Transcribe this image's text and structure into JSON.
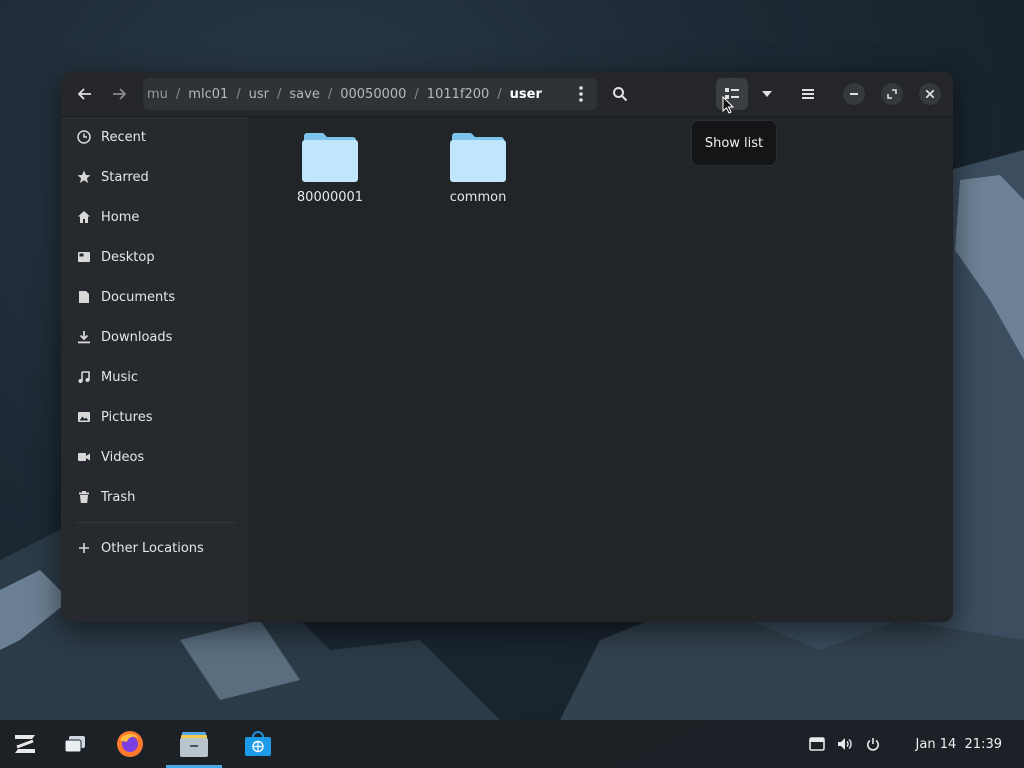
{
  "window": {
    "path": {
      "crumbs": [
        "mu",
        "mlc01",
        "usr",
        "save",
        "00050000",
        "1011f200",
        "user"
      ],
      "separator": "/"
    },
    "view_tooltip": "Show list"
  },
  "sidebar": {
    "items": [
      {
        "label": "Recent",
        "icon": "clock-icon"
      },
      {
        "label": "Starred",
        "icon": "star-icon"
      },
      {
        "label": "Home",
        "icon": "home-icon"
      },
      {
        "label": "Desktop",
        "icon": "desktop-icon"
      },
      {
        "label": "Documents",
        "icon": "document-icon"
      },
      {
        "label": "Downloads",
        "icon": "download-icon"
      },
      {
        "label": "Music",
        "icon": "music-icon"
      },
      {
        "label": "Pictures",
        "icon": "picture-icon"
      },
      {
        "label": "Videos",
        "icon": "video-icon"
      },
      {
        "label": "Trash",
        "icon": "trash-icon"
      }
    ],
    "other_locations": "Other Locations"
  },
  "files": [
    {
      "name": "80000001",
      "type": "folder"
    },
    {
      "name": "common",
      "type": "folder"
    }
  ],
  "taskbar": {
    "date": "Jan 14",
    "time": "21:39"
  },
  "colors": {
    "accent": "#49a8e8",
    "folder": "#a8dbf5"
  }
}
